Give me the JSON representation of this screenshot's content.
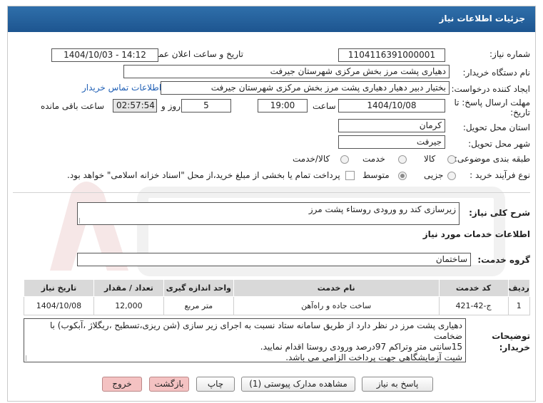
{
  "header": {
    "title": "جزئیات اطلاعات نیاز"
  },
  "fields": {
    "need_number_label": "شماره نیاز:",
    "need_number": "1104116391000001",
    "announce_label": "تاریخ و ساعت اعلان عمومی:",
    "announce_value": "1404/10/03 - 14:12",
    "buyer_label": "نام دستگاه خریدار:",
    "buyer_value": "دهیاری پشت مرز بخش مرکزی شهرستان جیرفت",
    "creator_label": "ایجاد کننده درخواست:",
    "creator_value": "بختیار دبیر دهیار دهیاری پشت مرز بخش مرکزی شهرستان جیرفت",
    "contact_link": "اطلاعات تماس خریدار",
    "deadline_label_1": "مهلت ارسال پاسخ: تا",
    "deadline_label_2": "تاریخ:",
    "deadline_date": "1404/10/08",
    "time_label": "ساعت",
    "deadline_time": "19:00",
    "days_value": "5",
    "days_label": "روز و",
    "remaining_value": "02:57:54",
    "remaining_label": "ساعت باقی مانده",
    "province_label": "استان محل تحویل:",
    "province_value": "کرمان",
    "city_label": "شهر محل تحویل:",
    "city_value": "جیرفت",
    "category_label": "طبقه بندی موضوعی:",
    "category_options": [
      "کالا",
      "خدمت",
      "کالا/خدمت"
    ],
    "purchase_label": "نوع فرآیند خرید :",
    "purchase_options": [
      "جزیی",
      "متوسط"
    ],
    "treasury_note": "پرداخت تمام یا بخشی از مبلغ خرید،از محل \"اسناد خزانه اسلامی\" خواهد بود."
  },
  "summary": {
    "label": "شرح کلی نیاز:",
    "value": "زیرسازی کند رو ورودی روستاء پشت مرز"
  },
  "services": {
    "section_title": "اطلاعات خدمات مورد نیاز",
    "group_label": "گروه خدمت:",
    "group_value": "ساختمان",
    "columns": [
      "ردیف",
      "کد خدمت",
      "نام خدمت",
      "واحد اندازه گیری",
      "تعداد / مقدار",
      "تاریخ نیاز"
    ],
    "rows": [
      {
        "row": "1",
        "code": "ج-42-421",
        "name": "ساخت جاده و راه‌آهن",
        "unit": "متر مربع",
        "qty": "12,000",
        "date": "1404/10/08"
      }
    ]
  },
  "buyer_notes": {
    "label_1": "توضیحات",
    "label_2": "خریدار:",
    "line_1": "دهیاری پشت مرز در نظر دارد از طریق سامانه ستاد نسبت به اجرای  زیر سازی (شن ریزی،تسطیح ،ریگلاژ ،آبکوب) با ضخامت",
    "line_2": "15سانتی متر وتراکم 97درصد  ورودی روستا اقدام نمایید.",
    "line_3": "شیت آزمایشگاهی جهت پرداخت الزامی می باشد."
  },
  "buttons": {
    "reply": "پاسخ به نیاز",
    "attachments": "مشاهده مدارک پیوستی (1)",
    "print": "چاپ",
    "back": "بازگشت",
    "exit": "خروج"
  },
  "colors": {
    "header_bg": "#2f6faa",
    "link": "#1f5fb5",
    "pink_button": "#f4c2c2"
  }
}
